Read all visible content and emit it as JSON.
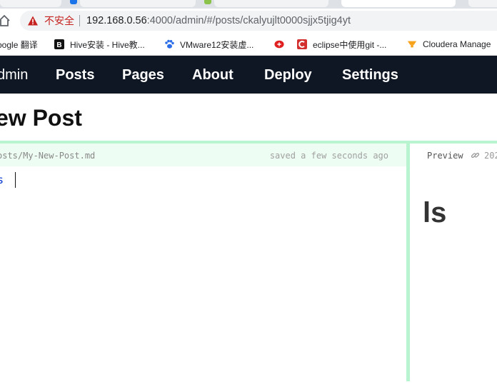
{
  "browser": {
    "security_label": "不安全",
    "url_host": "192.168.0.56",
    "url_path": ":4000/admin/#/posts/ckalyujlt0000sjjx5tjig4yt"
  },
  "bookmarks": [
    {
      "label": "oogle 翻译",
      "icon": "google-translate-icon"
    },
    {
      "label": "Hive安装 - Hive教...",
      "icon": "b-letter-icon"
    },
    {
      "label": "VMware12安装虚...",
      "icon": "paw-icon"
    },
    {
      "label": "",
      "icon": "red-logo-icon"
    },
    {
      "label": "eclipse中使用git -...",
      "icon": "c-letter-icon"
    },
    {
      "label": "Cloudera Manage",
      "icon": "cloudera-icon"
    }
  ],
  "nav": {
    "brand": "dmin",
    "links": [
      "Posts",
      "Pages",
      "About",
      "Deploy",
      "Settings"
    ]
  },
  "page": {
    "title": "ew Post"
  },
  "editor": {
    "file_path": "osts/My-New-Post.md",
    "save_status": "saved a few seconds ago",
    "content_line": "s"
  },
  "preview": {
    "tab_label": "Preview",
    "link_text": "202",
    "heading": "ls"
  },
  "colors": {
    "nav_bg": "#0f1724",
    "accent_green": "#b7f4cf",
    "editor_header_bg": "#eefdf3",
    "insecure_red": "#c5221f"
  }
}
